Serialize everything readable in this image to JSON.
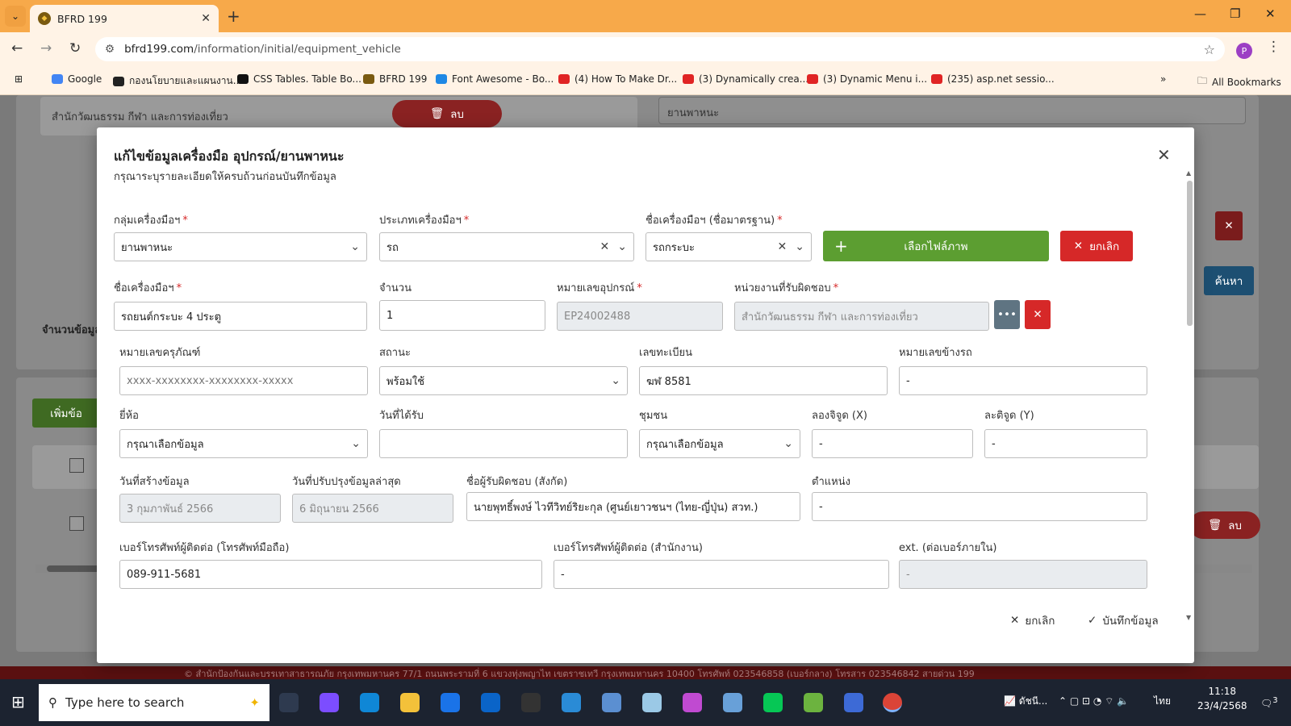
{
  "browser": {
    "tab_title": "BFRD 199",
    "url_host": "bfrd199.com",
    "url_path": "/information/initial/equipment_vehicle",
    "profile_initial": "P",
    "bookmarks": [
      {
        "label": "Google",
        "color": "#4285f4"
      },
      {
        "label": "กองนโยบายและแผนงาน...",
        "color": "#222222"
      },
      {
        "label": "CSS Tables. Table Bo...",
        "color": "#111111"
      },
      {
        "label": "BFRD 199",
        "color": "#7a5a10"
      },
      {
        "label": "Font Awesome - Bo...",
        "color": "#1e88e5"
      },
      {
        "label": "(4) How To Make Dr...",
        "color": "#e02424"
      },
      {
        "label": "(3) Dynamically crea...",
        "color": "#e02424"
      },
      {
        "label": "(3) Dynamic Menu i...",
        "color": "#e02424"
      },
      {
        "label": "(235) asp.net sessio...",
        "color": "#e02424"
      }
    ],
    "all_bookmarks": "All Bookmarks"
  },
  "background": {
    "org_text": "สำนักวัฒนธรรม กีฬา และการท่องเที่ยว",
    "delete_label": "ลบ",
    "vehicle_select": "ยานพาหนะ",
    "search_label": "ค้นหา",
    "count_label": "จำนวนข้อมูล",
    "add_label": "เพิ่มข้อ",
    "row_delete": "ลบ",
    "footer_text": "© สำนักป้องกันและบรรเทาสาธารณภัย กรุงเทพมหานคร 77/1 ถนนพระรามที่ 6 แขวงทุ่งพญาไท เขตราชเทวี กรุงเทพมหานคร 10400 โทรศัพท์ 023546858 (เบอร์กลาง) โทรสาร 023546842 สายด่วน 199"
  },
  "modal": {
    "title": "แก้ไขข้อมูลเครื่องมือ อุปกรณ์/ยานพาหนะ",
    "subtitle": "กรุณาระบุรายละเอียดให้ครบถ้วนก่อนบันทึกข้อมูล",
    "fields": {
      "group_label": "กลุ่มเครื่องมือฯ",
      "group_value": "ยานพาหนะ",
      "type_label": "ประเภทเครื่องมือฯ",
      "type_value": "รถ",
      "std_name_label": "ชื่อเครื่องมือฯ (ชื่อมาตรฐาน)",
      "std_name_value": "รถกระบะ",
      "choose_image": "เลือกไฟล์ภาพ",
      "cancel_image": "ยกเลิก",
      "name_label": "ชื่อเครื่องมือฯ",
      "name_value": "รถยนต์กระบะ 4 ประตู",
      "qty_label": "จำนวน",
      "qty_value": "1",
      "equip_no_label": "หมายเลขอุปกรณ์",
      "equip_no_value": "EP24002488",
      "unit_label": "หน่วยงานที่รับผิดชอบ",
      "unit_value": "สำนักวัฒนธรรม กีฬา และการท่องเที่ยว",
      "asset_no_label": "หมายเลขครุภัณฑ์",
      "asset_no_placeholder": "xxxx-xxxxxxxx-xxxxxxxx-xxxxx",
      "status_label": "สถานะ",
      "status_value": "พร้อมใช้",
      "plate_label": "เลขทะเบียน",
      "plate_value": "ฆฬ 8581",
      "side_no_label": "หมายเลขข้างรถ",
      "side_no_value": "-",
      "brand_label": "ยี่ห้อ",
      "brand_value": "กรุณาเลือกข้อมูล",
      "received_label": "วันที่ได้รับ",
      "received_value": "",
      "community_label": "ชุมชน",
      "community_value": "กรุณาเลือกข้อมูล",
      "lon_label": "ลองจิจูด (X)",
      "lon_value": "-",
      "lat_label": "ละติจูด (Y)",
      "lat_value": "-",
      "created_label": "วันที่สร้างข้อมูล",
      "created_value": "3 กุมภาพันธ์ 2566",
      "updated_label": "วันที่ปรับปรุงข้อมูลล่าสุด",
      "updated_value": "6 มิถุนายน 2566",
      "resp_label": "ชื่อผู้รับผิดชอบ (สังกัด)",
      "resp_value": "นายพุทธิ์พงษ์ ไวทีวิทย์ริยะกุล (ศูนย์เยาวชนฯ (ไทย-ญี่ปุ่น) สวท.)",
      "position_label": "ตำแหน่ง",
      "position_value": "-",
      "mobile_label": "เบอร์โทรศัพท์ผู้ติดต่อ (โทรศัพท์มือถือ)",
      "mobile_value": "089-911-5681",
      "office_label": "เบอร์โทรศัพท์ผู้ติดต่อ (สำนักงาน)",
      "office_value": "-",
      "ext_label": "ext. (ต่อเบอร์ภายใน)",
      "ext_value": "-"
    },
    "cancel_label": "ยกเลิก",
    "save_label": "บันทึกข้อมูล"
  },
  "taskbar": {
    "search_placeholder": "Type here to search",
    "weather": "ดัชนี...",
    "lang": "ไทย",
    "time": "11:18",
    "date": "23/4/2568",
    "notif_count": "3"
  },
  "colors": {
    "tab_bar": "#f7a94a",
    "green": "#5c9e31",
    "red": "#d62828",
    "gray_btn": "#5f7482"
  }
}
